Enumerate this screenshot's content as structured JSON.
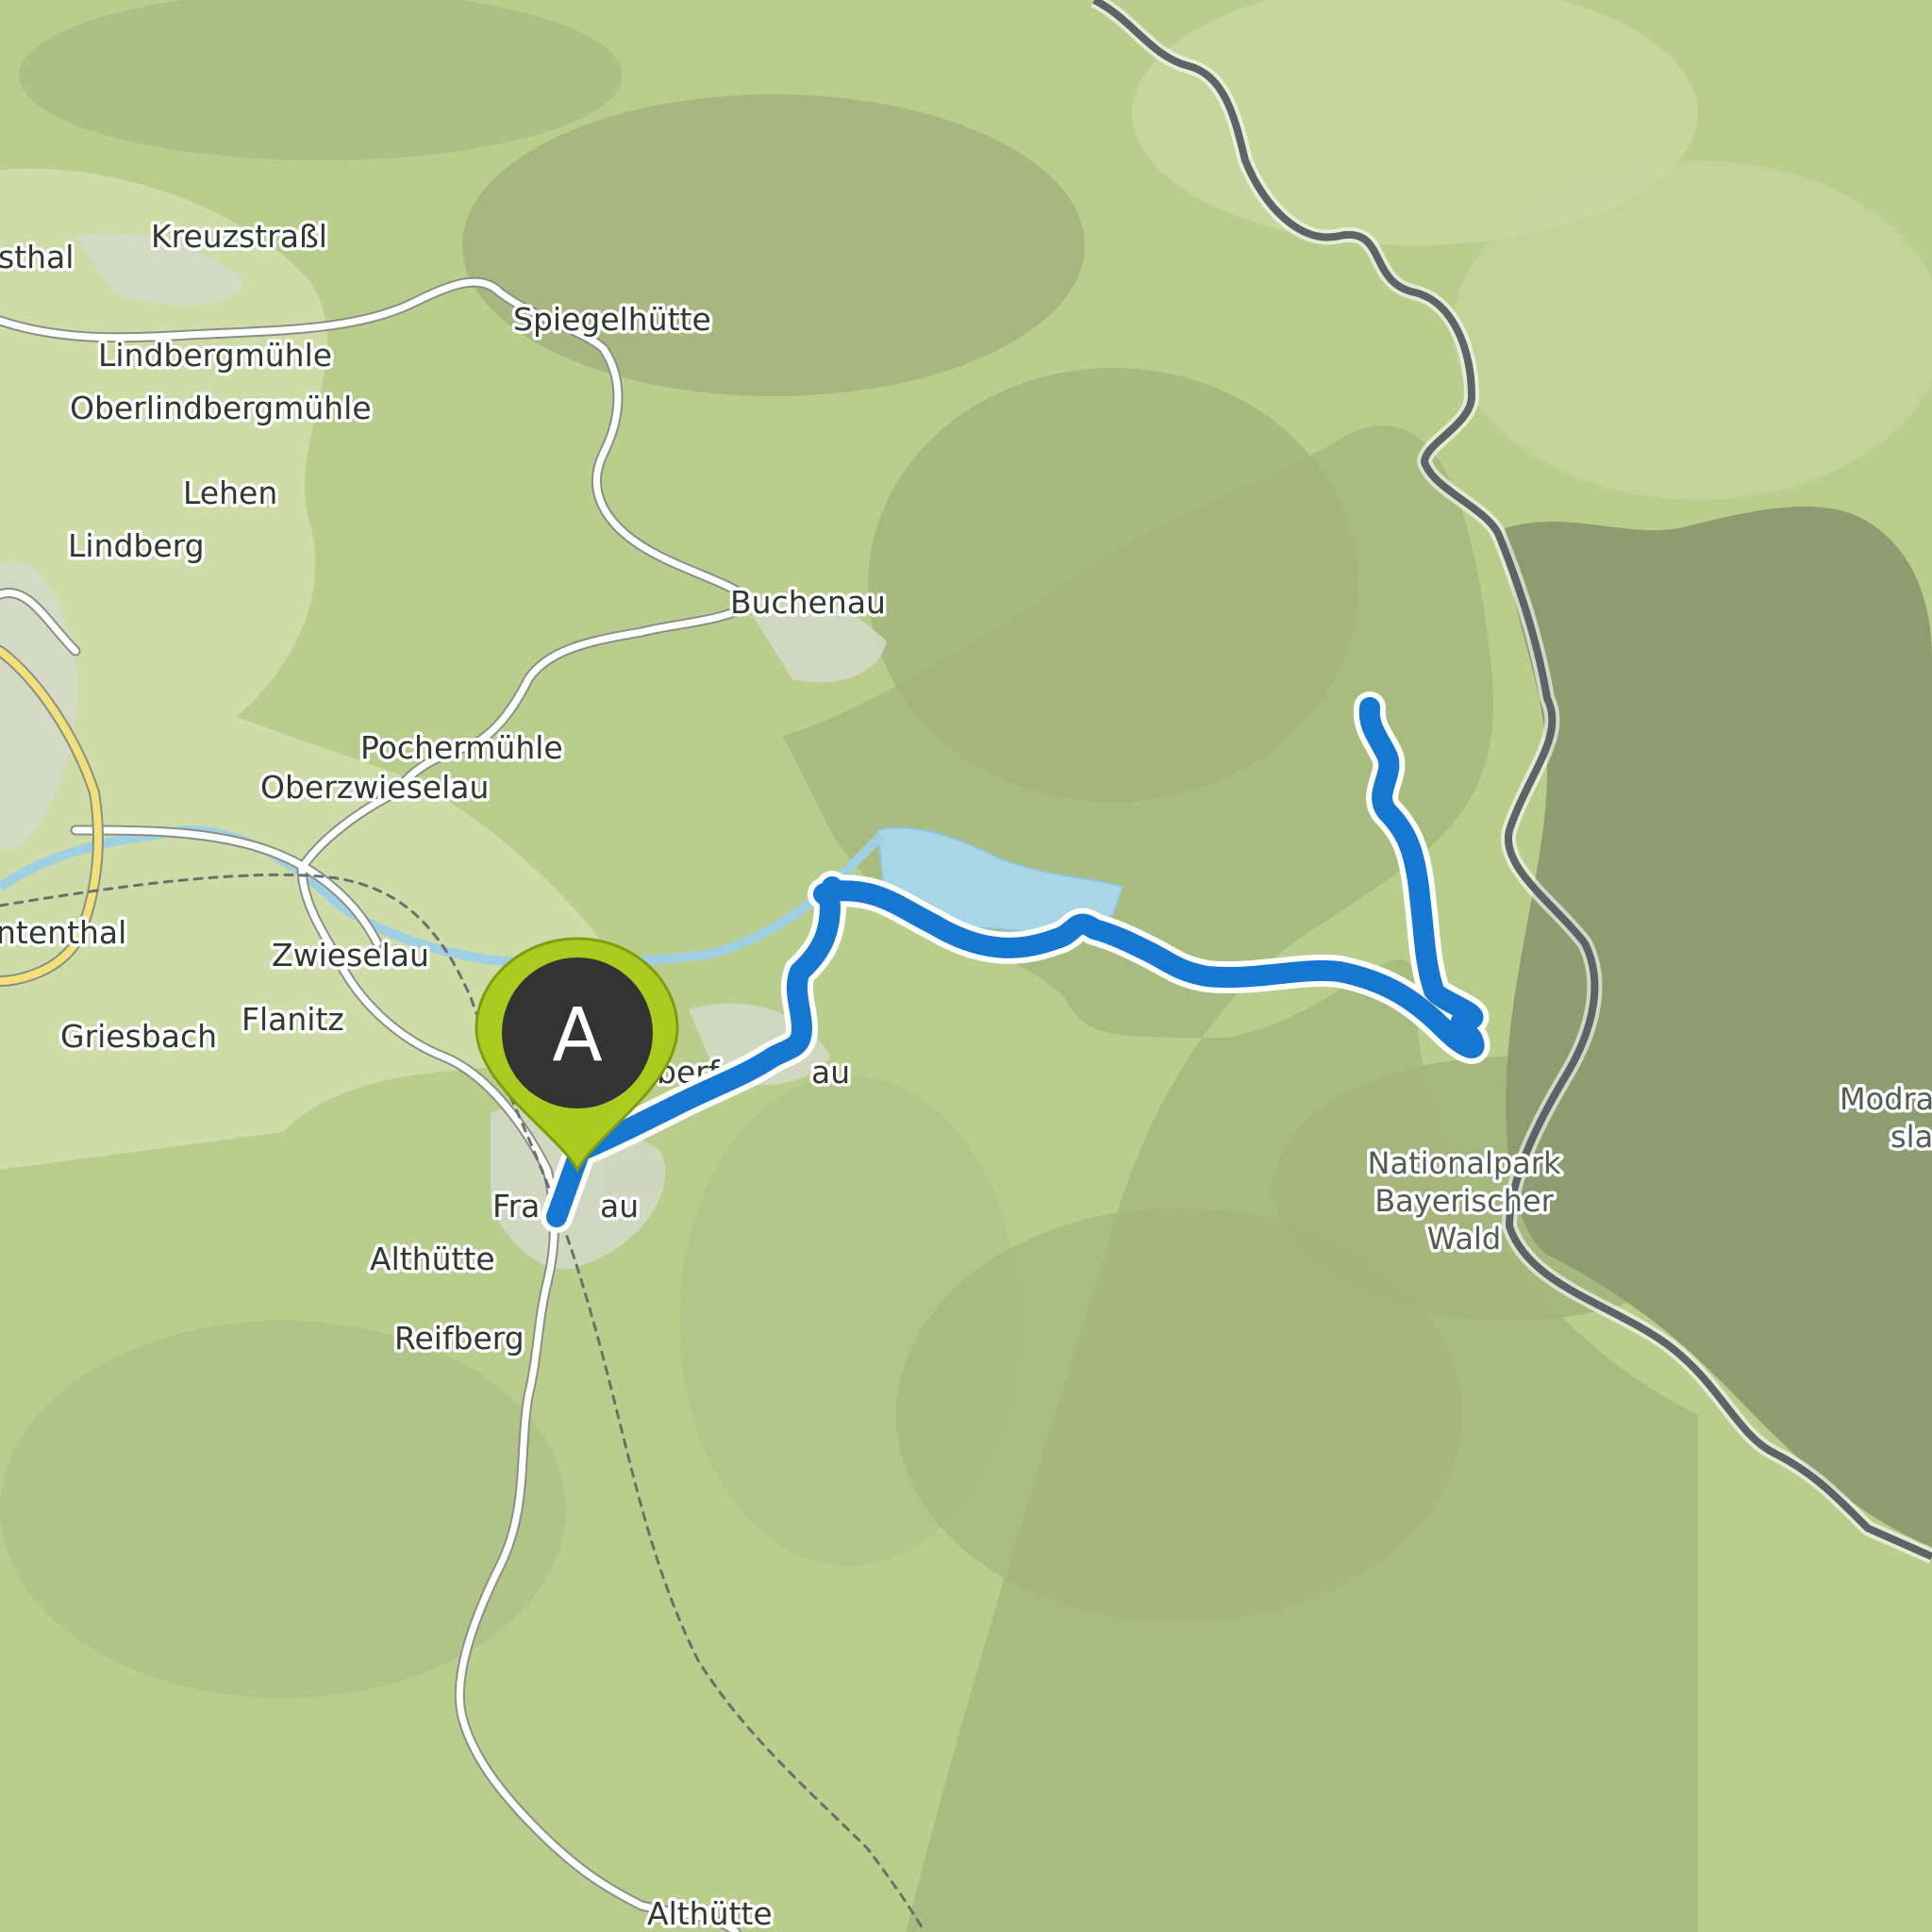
{
  "map": {
    "colors": {
      "terrain": "#b9cd8c",
      "forest": "#a4b67c",
      "protected_area": "#8e9d70",
      "water": "#a9d6e4",
      "route": "#1677d2",
      "border": "#5b6466",
      "marker": "#a9cc1f",
      "marker_inner": "#333333"
    },
    "marker": {
      "letter": "A"
    },
    "labels": {
      "kreuzstrassl": "Kreuzstraßl",
      "thal_partial": "sthal",
      "spiegelhuette": "Spiegelhütte",
      "lindbergmuehle": "Lindbergmühle",
      "oberlindbergmuehle": "Oberlindbergmühle",
      "lehen": "Lehen",
      "lindberg": "Lindberg",
      "buchenau": "Buchenau",
      "pochermuehle": "Pochermühle",
      "oberzwieselau": "Oberzwieselau",
      "tenthal_partial": "ntenthal",
      "zwieselau": "Zwieselau",
      "griesbach": "Griesbach",
      "flanitz": "Flanitz",
      "oberfrauenau_partial": "berf",
      "oberfrauenau_end": "au",
      "frauenau_start": "Fra",
      "frauenau_end": "au",
      "althuette": "Althütte",
      "reifberg": "Reifberg",
      "althuette_south": "Althütte",
      "nationalpark_1": "Nationalpark",
      "nationalpark_2": "Bayerischer",
      "nationalpark_3": "Wald",
      "modrava_1": "Modra",
      "modrava_2": "sla"
    },
    "icons": {
      "start_marker": "map-pin-icon"
    }
  }
}
